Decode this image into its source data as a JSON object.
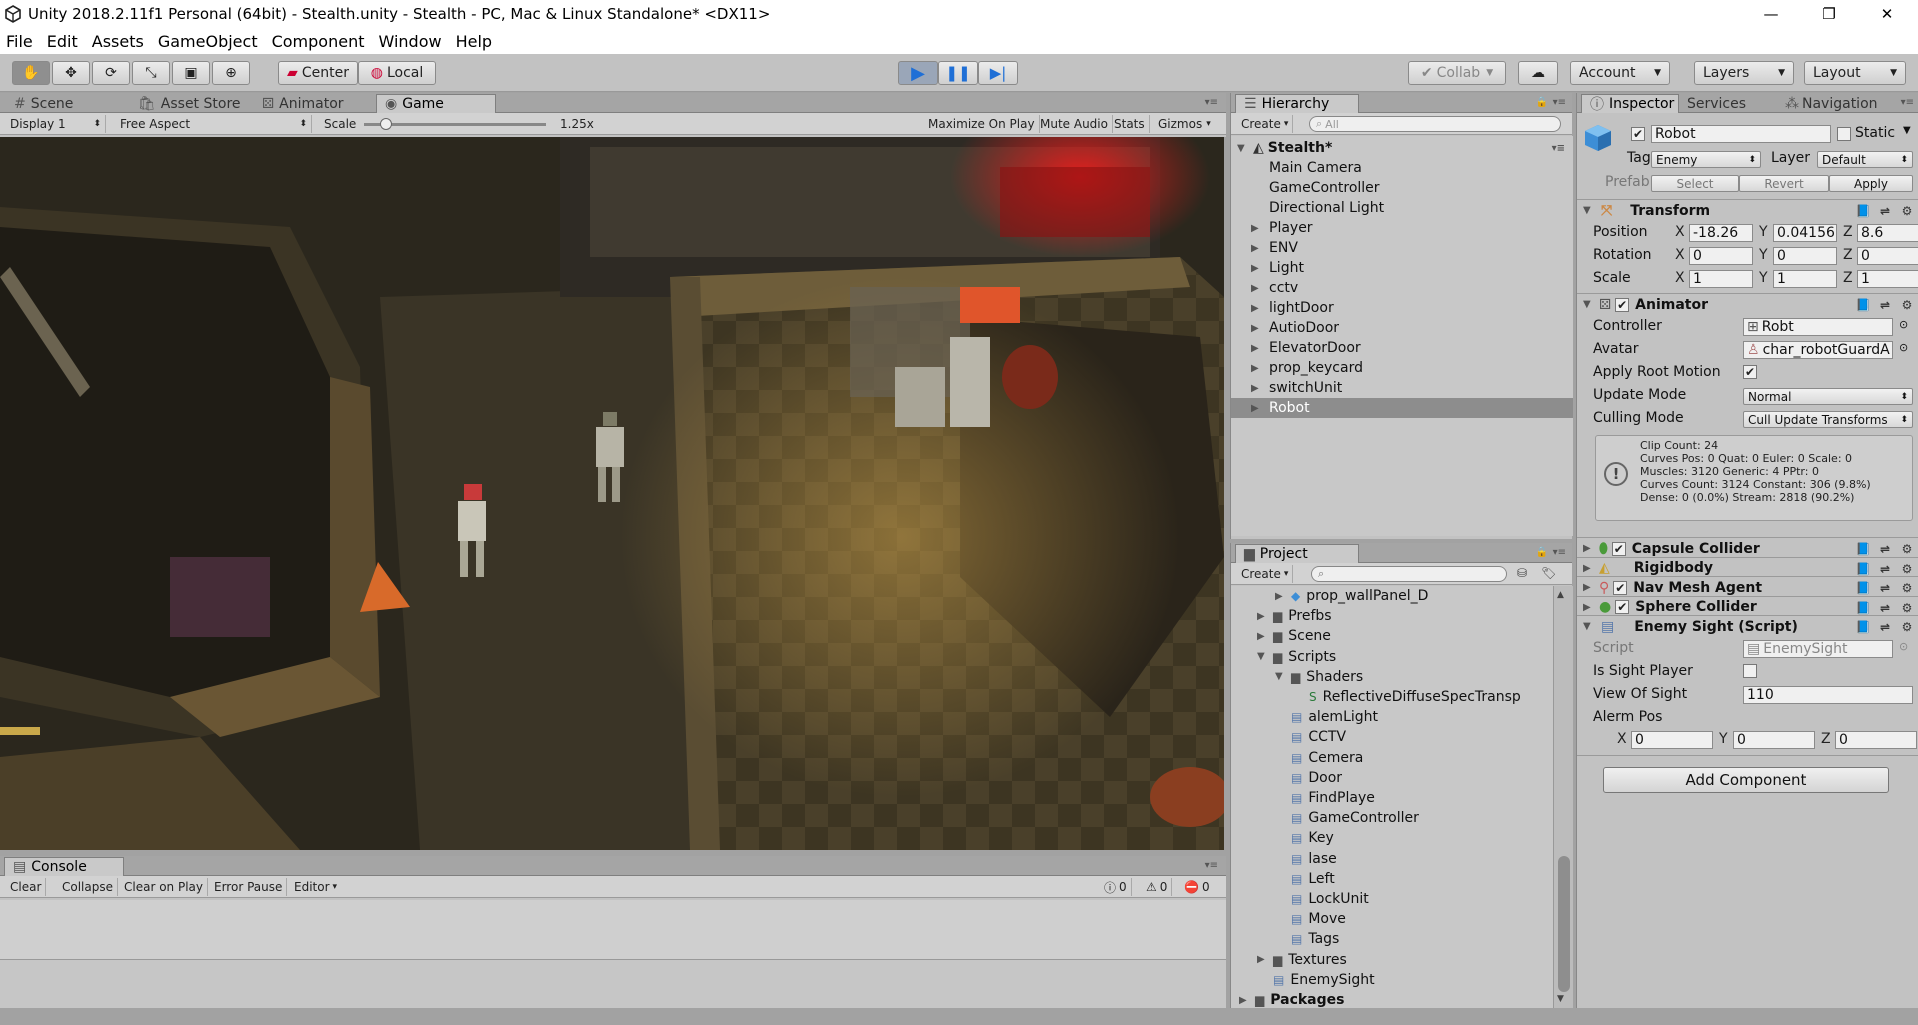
{
  "window": {
    "title": "Unity 2018.2.11f1 Personal (64bit) - Stealth.unity - Stealth - PC, Mac & Linux Standalone* <DX11>"
  },
  "menu": [
    "File",
    "Edit",
    "Assets",
    "GameObject",
    "Component",
    "Window",
    "Help"
  ],
  "toolbar": {
    "pivot": "Center",
    "space": "Local",
    "collab": "Collab",
    "account": "Account",
    "layers": "Layers",
    "layout": "Layout"
  },
  "tabs": {
    "scene": "Scene",
    "asset_store": "Asset Store",
    "animator": "Animator",
    "game": "Game"
  },
  "game_bar": {
    "display": "Display 1",
    "aspect": "Free Aspect",
    "scale_label": "Scale",
    "scale_value": "1.25x",
    "scale_fraction": 0.12,
    "maximize": "Maximize On Play",
    "mute": "Mute Audio",
    "stats": "Stats",
    "gizmos": "Gizmos"
  },
  "console": {
    "tab": "Console",
    "clear": "Clear",
    "collapse": "Collapse",
    "clear_on_play": "Clear on Play",
    "error_pause": "Error Pause",
    "editor": "Editor",
    "log_count": "0",
    "warn_count": "0",
    "err_count": "0"
  },
  "hierarchy": {
    "tab": "Hierarchy",
    "create": "Create",
    "search_placeholder": "All",
    "scene": "Stealth*",
    "items": [
      {
        "label": "Main Camera",
        "expandable": false
      },
      {
        "label": "GameController",
        "expandable": false
      },
      {
        "label": "Directional Light",
        "expandable": false
      },
      {
        "label": "Player",
        "expandable": true
      },
      {
        "label": "ENV",
        "expandable": true
      },
      {
        "label": "Light",
        "expandable": true
      },
      {
        "label": "cctv",
        "expandable": true
      },
      {
        "label": "lightDoor",
        "expandable": true
      },
      {
        "label": "AutioDoor",
        "expandable": true
      },
      {
        "label": "ElevatorDoor",
        "expandable": true
      },
      {
        "label": "prop_keycard",
        "expandable": true
      },
      {
        "label": "switchUnit",
        "expandable": true
      },
      {
        "label": "Robot",
        "expandable": true,
        "selected": true
      }
    ]
  },
  "project": {
    "tab": "Project",
    "create": "Create",
    "items": [
      {
        "label": "prop_wallPanel_D",
        "indent": 2,
        "kind": "prefab",
        "tri": "▶"
      },
      {
        "label": "Prefbs",
        "indent": 1,
        "kind": "folder",
        "tri": "▶"
      },
      {
        "label": "Scene",
        "indent": 1,
        "kind": "folder",
        "tri": "▶"
      },
      {
        "label": "Scripts",
        "indent": 1,
        "kind": "folder",
        "tri": "▼"
      },
      {
        "label": "Shaders",
        "indent": 2,
        "kind": "folder",
        "tri": "▼"
      },
      {
        "label": "ReflectiveDiffuseSpecTransp",
        "indent": 3,
        "kind": "shader",
        "tri": ""
      },
      {
        "label": "alemLight",
        "indent": 2,
        "kind": "script",
        "tri": ""
      },
      {
        "label": "CCTV",
        "indent": 2,
        "kind": "script",
        "tri": ""
      },
      {
        "label": "Cemera",
        "indent": 2,
        "kind": "script",
        "tri": ""
      },
      {
        "label": "Door",
        "indent": 2,
        "kind": "script",
        "tri": ""
      },
      {
        "label": "FindPlaye",
        "indent": 2,
        "kind": "script",
        "tri": ""
      },
      {
        "label": "GameController",
        "indent": 2,
        "kind": "script",
        "tri": ""
      },
      {
        "label": "Key",
        "indent": 2,
        "kind": "script",
        "tri": ""
      },
      {
        "label": "lase",
        "indent": 2,
        "kind": "script",
        "tri": ""
      },
      {
        "label": "Left",
        "indent": 2,
        "kind": "script",
        "tri": ""
      },
      {
        "label": "LockUnit",
        "indent": 2,
        "kind": "script",
        "tri": ""
      },
      {
        "label": "Move",
        "indent": 2,
        "kind": "script",
        "tri": ""
      },
      {
        "label": "Tags",
        "indent": 2,
        "kind": "script",
        "tri": ""
      },
      {
        "label": "Textures",
        "indent": 1,
        "kind": "folder",
        "tri": "▶"
      },
      {
        "label": "EnemySight",
        "indent": 1,
        "kind": "script",
        "tri": ""
      },
      {
        "label": "Packages",
        "indent": 0,
        "kind": "folder",
        "tri": "▶",
        "bold": true
      }
    ]
  },
  "inspector": {
    "tab": "Inspector",
    "services": "Services",
    "navigation": "Navigation",
    "name": "Robot",
    "static": "Static",
    "tag_label": "Tag",
    "tag": "Enemy",
    "layer_label": "Layer",
    "layer": "Default",
    "prefab_label": "Prefab",
    "select": "Select",
    "revert": "Revert",
    "apply": "Apply",
    "transform": {
      "title": "Transform",
      "position_label": "Position",
      "position": [
        "-18.26",
        "0.04156",
        "8.6"
      ],
      "rotation_label": "Rotation",
      "rotation": [
        "0",
        "0",
        "0"
      ],
      "scale_label": "Scale",
      "scale": [
        "1",
        "1",
        "1"
      ]
    },
    "animator": {
      "title": "Animator",
      "controller_label": "Controller",
      "controller": "Robt",
      "avatar_label": "Avatar",
      "avatar": "char_robotGuardA",
      "root_motion_label": "Apply Root Motion",
      "update_mode_label": "Update Mode",
      "update_mode": "Normal",
      "culling_label": "Culling Mode",
      "culling": "Cull Update Transforms",
      "info": [
        "Clip Count: 24",
        "Curves Pos: 0 Quat: 0 Euler: 0 Scale: 0",
        "Muscles: 3120 Generic: 4 PPtr: 0",
        "Curves Count: 3124 Constant: 306 (9.8%)",
        "Dense: 0 (0.0%) Stream: 2818 (90.2%)"
      ]
    },
    "components": [
      "Capsule Collider",
      "Rigidbody",
      "Nav Mesh Agent",
      "Sphere Collider"
    ],
    "enemy_sight": {
      "title": "Enemy Sight (Script)",
      "script_label": "Script",
      "script": "EnemySight",
      "is_sight_label": "Is Sight Player",
      "view_label": "View Of Sight",
      "view": "110",
      "alerm_label": "Alerm Pos",
      "alerm": [
        "0",
        "0",
        "0"
      ]
    },
    "add_component": "Add Component"
  },
  "axis_letters": [
    "X",
    "Y",
    "Z"
  ]
}
